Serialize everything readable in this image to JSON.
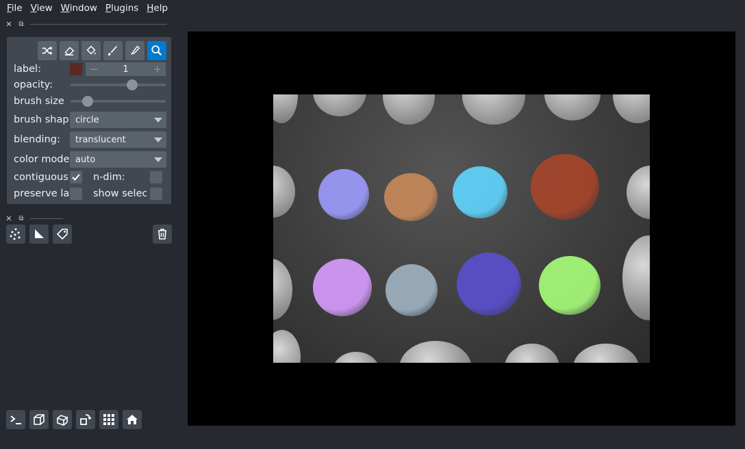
{
  "menu": {
    "items": [
      {
        "first": "F",
        "rest": "ile"
      },
      {
        "first": "V",
        "rest": "iew"
      },
      {
        "first": "W",
        "rest": "indow"
      },
      {
        "first": "P",
        "rest": "lugins"
      },
      {
        "first": "H",
        "rest": "elp"
      }
    ]
  },
  "dock": {
    "close_glyph": "✕",
    "float_glyph": "⧉"
  },
  "controls": {
    "tools": [
      "shuffle-icon",
      "eraser-icon",
      "fill-icon",
      "paintbrush-icon",
      "picker-icon",
      "zoom-icon"
    ],
    "active_tool": "zoom-icon",
    "label_text": "label:",
    "label_value": "1",
    "label_color": "#5a2a22",
    "minus": "−",
    "plus": "+",
    "opacity_text": "opacity:",
    "opacity_value": 0.67,
    "brush_size_text": "brush size",
    "brush_size_value": 0.14,
    "brush_shape_text": "brush shap",
    "brush_shape_value": "circle",
    "blending_text": "blending:",
    "blending_value": "translucent",
    "color_mode_text": "color mode",
    "color_mode_value": "auto",
    "contiguous_text": "contiguous",
    "contiguous_checked": true,
    "ndim_text": "n-dim:",
    "ndim_checked": false,
    "preserve_text": "preserve la",
    "preserve_checked": false,
    "show_selected_text": "show selec",
    "show_selected_checked": false
  },
  "layer_buttons": [
    "points-icon",
    "shapes-icon",
    "labels-icon",
    "delete-icon"
  ],
  "bottom_buttons": [
    "console-icon",
    "ndisplay-icon",
    "roll-icon",
    "transpose-icon",
    "grid-icon",
    "home-icon"
  ],
  "canvas": {
    "label_colors": [
      "#9c9cff",
      "#c8895a",
      "#5fd6ff",
      "#a8452a",
      "#d99cff",
      "#9fb3c3",
      "#5a4fd0",
      "#a8ff7a"
    ]
  }
}
